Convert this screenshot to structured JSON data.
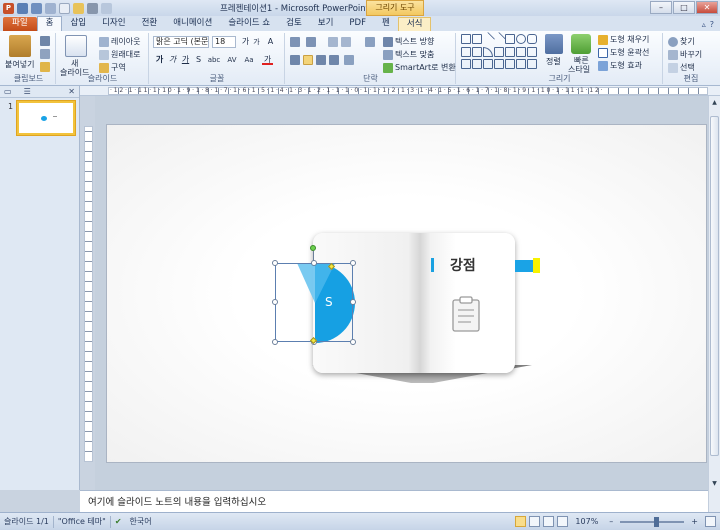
{
  "window": {
    "title": "프레젠테이션1 - Microsoft PowerPoint",
    "context_tab_head": "그리기 도구",
    "ppt_logo": "P",
    "minimize": "–",
    "maximize": "□",
    "close": "✕"
  },
  "tabs": [
    "파일",
    "홈",
    "삽입",
    "디자인",
    "전환",
    "애니메이션",
    "슬라이드 쇼",
    "검토",
    "보기",
    "PDF",
    "펜",
    "서식"
  ],
  "tabs_right": [
    "▵",
    "?"
  ],
  "ribbon": {
    "clipboard": {
      "label": "클립보드",
      "paste": "붙여넣기"
    },
    "slides": {
      "label": "슬라이드",
      "new_slide": "새",
      "new_slide2": "슬라이드",
      "layout": "레이아웃",
      "reset": "원래대로",
      "section": "구역"
    },
    "font": {
      "label": "글꼴",
      "font_name": "맑은 고딕 (본문)",
      "font_size": "18",
      "bold": "가",
      "italic": "가",
      "underline": "가",
      "strike": "S",
      "shadow": "abc",
      "spacing": "AV",
      "case": "Aa",
      "color": "가",
      "grow": "가",
      "shrink": "가",
      "clear": "A"
    },
    "paragraph": {
      "label": "단락",
      "text_direction": "텍스트 방향",
      "align_text": "텍스트 맞춤",
      "smartart": "SmartArt로 변환"
    },
    "drawing": {
      "label": "그리기",
      "arrange": "정렬",
      "quick_styles": "빠른",
      "quick_styles2": "스타일",
      "fill": "도형 채우기",
      "outline": "도형 윤곽선",
      "effects": "도형 효과"
    },
    "editing": {
      "label": "편집",
      "find": "찾기",
      "replace": "바꾸기",
      "select": "선택"
    }
  },
  "ruler": {
    "marks": "·12·1·11·1·10·1·9·1·8·1·7·1·6·1·5·1·4·1·3·1·2·1·1·1·0·1·1·1·2·1·3·1·4·1·5·1·6·1·7·1·8·1·9·1·10·1·11·1·12·"
  },
  "left_panel": {
    "tab_slides": "▭",
    "tab_outline": "☰",
    "close": "✕",
    "thumb_number": "1"
  },
  "slide": {
    "title": "강점",
    "shape_letter": "S"
  },
  "notes": {
    "placeholder": "여기에 슬라이드 노트의 내용을 입력하십시오"
  },
  "status": {
    "slide_info": "슬라이드 1/1",
    "theme": "\"Office 테마\"",
    "language": "한국어",
    "zoom": "107%",
    "zoom_minus": "–",
    "zoom_plus": "+"
  },
  "colors": {
    "accent_blue": "#1aa3e6",
    "accent_yellow": "#f7f200",
    "file_tab": "#c44c19"
  }
}
